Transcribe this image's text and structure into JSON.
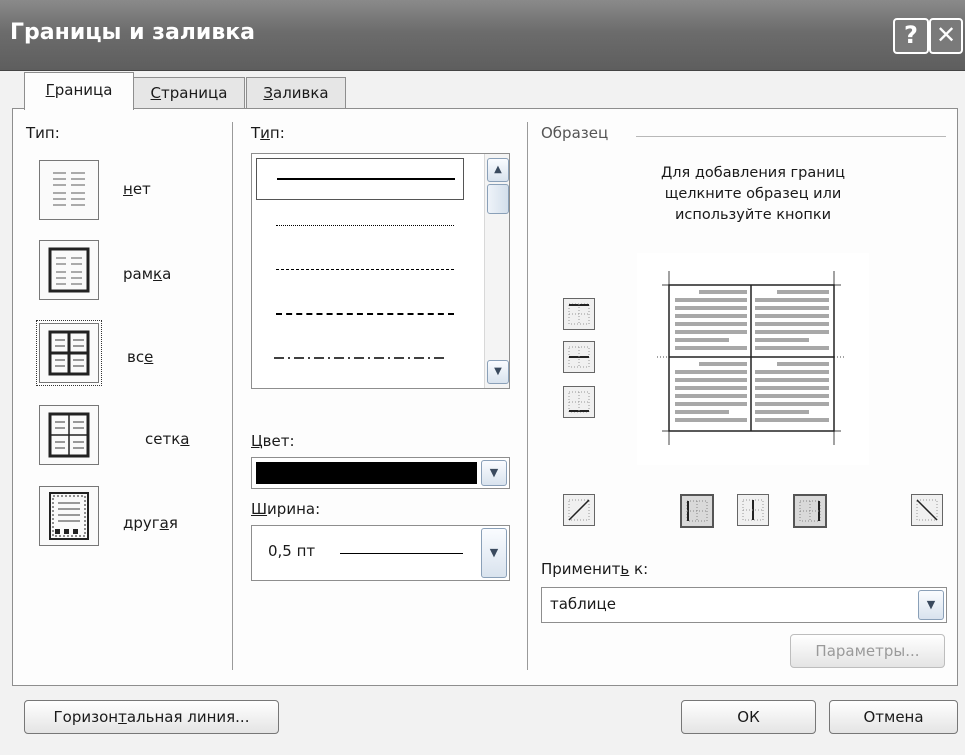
{
  "window": {
    "title": "Границы и заливка",
    "help_glyph": "?",
    "close_glyph": "✕"
  },
  "tabs": [
    {
      "label": "Граница",
      "accel": "Г",
      "rest": "раница",
      "active": true
    },
    {
      "label": "Страница",
      "accel": "С",
      "rest": "траница",
      "active": false
    },
    {
      "label": "Заливка",
      "accel": "З",
      "rest": "аливка",
      "active": false
    }
  ],
  "setting": {
    "label": "Тип:",
    "items": [
      {
        "label": "нет",
        "pre": "",
        "accel": "н",
        "post": "ет",
        "icon": "border-none-icon"
      },
      {
        "label": "рамка",
        "pre": "рам",
        "accel": "к",
        "post": "а",
        "icon": "border-box-icon"
      },
      {
        "label": "все",
        "pre": "вс",
        "accel": "е",
        "post": "",
        "icon": "border-all-icon",
        "selected": true
      },
      {
        "label": "сетка",
        "pre": "сетк",
        "accel": "а",
        "post": "",
        "icon": "border-grid-icon"
      },
      {
        "label": "другая",
        "pre": "друг",
        "accel": "а",
        "post": "я",
        "icon": "border-custom-icon"
      }
    ]
  },
  "style": {
    "label": "Тип:",
    "label_pre": "Т",
    "label_accel": "и",
    "label_post": "п:",
    "lines": [
      "solid",
      "dotted",
      "dashed-small",
      "dashed",
      "dash-dot"
    ],
    "selected_index": 0
  },
  "color": {
    "label": "Цвет:",
    "label_accel": "Ц",
    "label_rest": "вет:",
    "value": "#000000"
  },
  "width": {
    "label": "Ширина:",
    "label_accel": "Ш",
    "label_rest": "ирина:",
    "value": "0,5 пт"
  },
  "preview": {
    "section_label": "Образец",
    "hint_lines": [
      "Для добавления границ",
      "щелкните образец или",
      "используйте кнопки"
    ]
  },
  "apply_to": {
    "label": "Применить к:",
    "label_pre": "Применит",
    "label_accel": "ь",
    "label_post": " к:",
    "value": "таблице"
  },
  "buttons": {
    "options": "Параметры...",
    "horizontal_line": "Горизонтальная линия...",
    "horizontal_line_pre": "Горизон",
    "horizontal_line_accel": "т",
    "horizontal_line_post": "альная линия...",
    "ok": "ОК",
    "cancel": "Отмена"
  },
  "colors": {
    "title_bar": "#6c6c6c",
    "panel": "#fdfdfd",
    "scroll_accent": "#8aa0b8"
  }
}
